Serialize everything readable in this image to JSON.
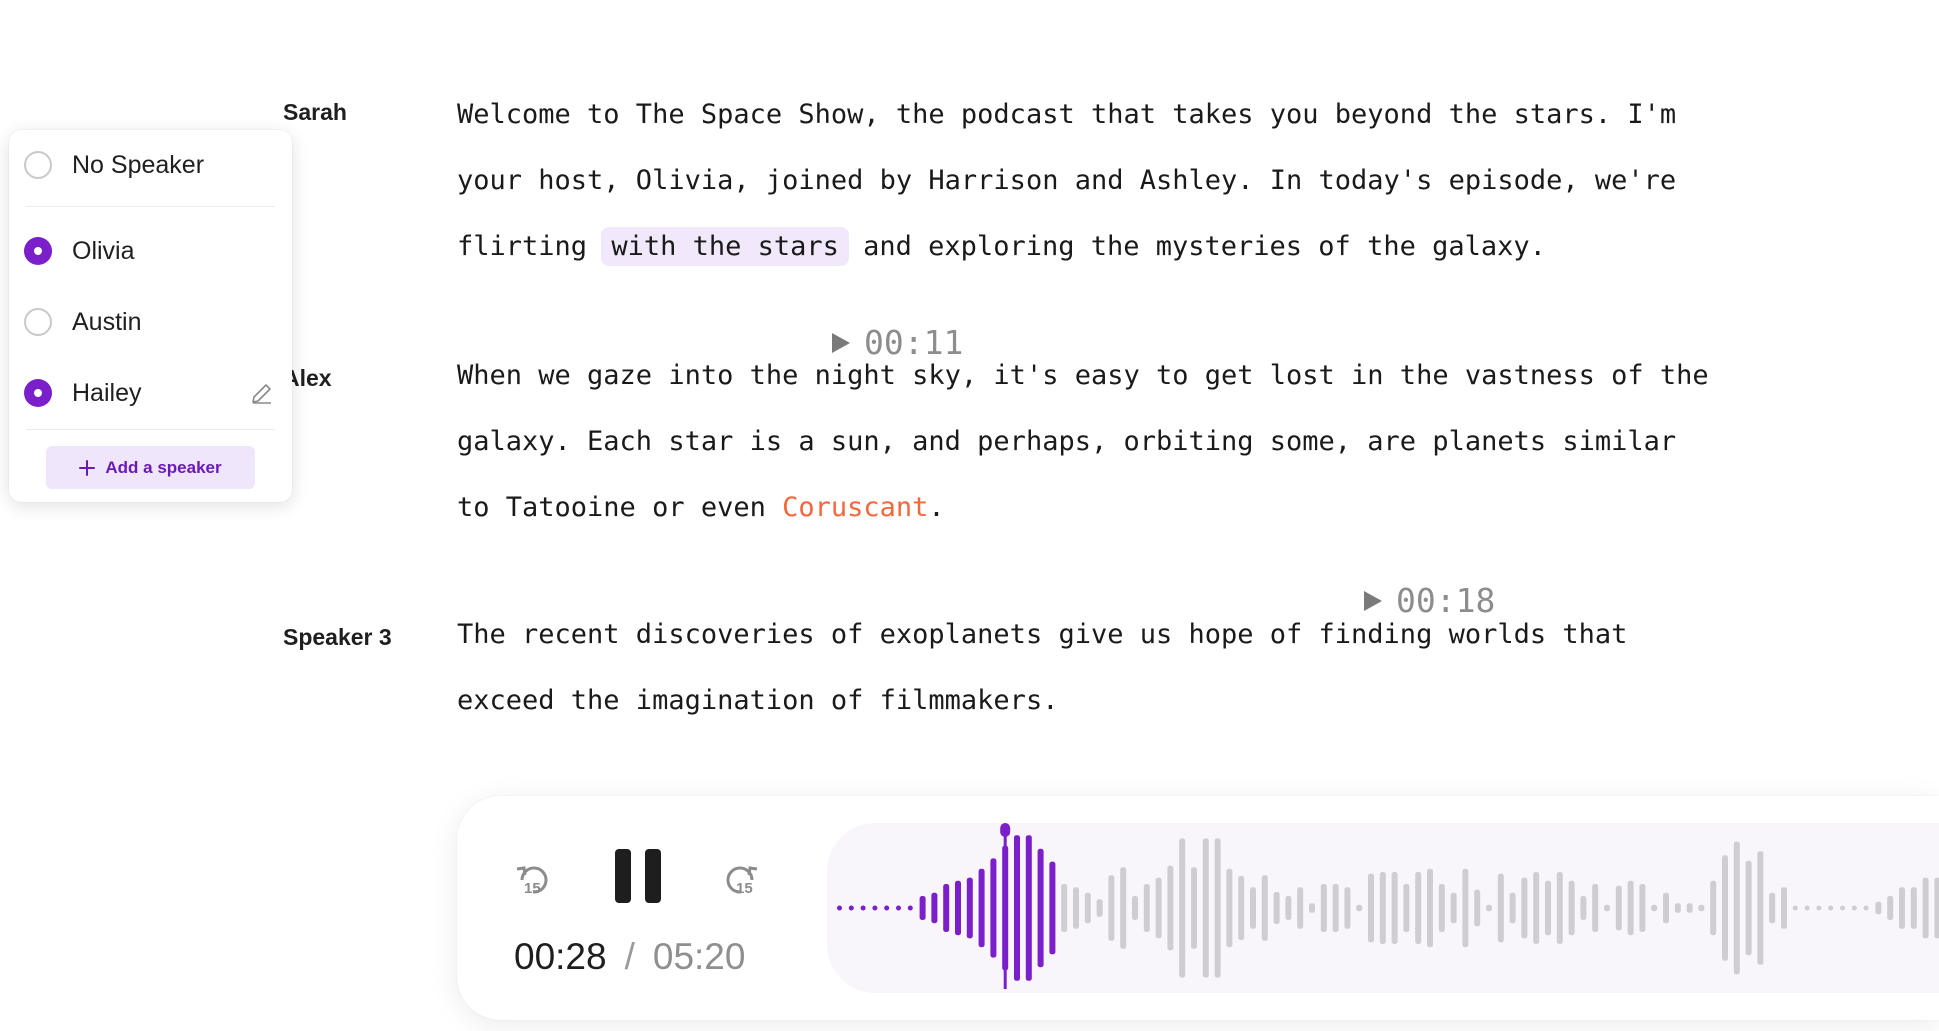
{
  "transcript": {
    "blocks": [
      {
        "speaker": "Sarah",
        "lines": [
          [
            {
              "t": "Welcome to The Space Show, the podcast that takes you beyond the stars. I'm"
            }
          ],
          [
            {
              "t": "your host, Olivia, joined by Harrison and Ashley. In today's episode, we're"
            }
          ],
          [
            {
              "t": "flirting "
            },
            {
              "t": "with the stars",
              "style": "highlight"
            },
            {
              "t": " and exploring the mysteries of the galaxy."
            }
          ]
        ]
      },
      {
        "speaker": "Alex",
        "timestamp": "00:11",
        "lines": [
          [
            {
              "t": "When we gaze into the night sky, it's easy to get lost in the vastness of the"
            }
          ],
          [
            {
              "t": "galaxy. Each star is a sun, and perhaps, orbiting some, are planets similar"
            }
          ],
          [
            {
              "t": "to Tatooine or even "
            },
            {
              "t": "Coruscant",
              "style": "error"
            },
            {
              "t": "."
            }
          ]
        ]
      },
      {
        "speaker": "Speaker 3",
        "timestamp": "00:18",
        "lines": [
          [
            {
              "t": "The recent discoveries of exoplanets give us hope of finding worlds that"
            }
          ],
          [
            {
              "t": "exceed the imagination of filmmakers."
            }
          ]
        ]
      }
    ]
  },
  "speaker_menu": {
    "options": [
      {
        "label": "No Speaker",
        "selected": false
      },
      {
        "label": "Olivia",
        "selected": true
      },
      {
        "label": "Austin",
        "selected": false
      },
      {
        "label": "Hailey",
        "selected": true,
        "editable": true
      }
    ],
    "add_label": "Add a speaker"
  },
  "player": {
    "current_time": "00:28",
    "separator": "/",
    "total_time": "05:20",
    "skip_back_label": "15",
    "skip_forward_label": "15",
    "state": "playing",
    "progress_fraction": 0.0875,
    "colors": {
      "played": "#7a1fc9",
      "unplayed": "#cfcdd2",
      "accent": "#7a1fc9"
    },
    "waveform_levels": [
      0.03,
      0.03,
      0.03,
      0.03,
      0.03,
      0.03,
      0.03,
      0.15,
      0.19,
      0.3,
      0.34,
      0.38,
      0.49,
      0.62,
      0.78,
      0.91,
      0.91,
      0.74,
      0.58,
      0.3,
      0.26,
      0.19,
      0.11,
      0.41,
      0.51,
      0.15,
      0.3,
      0.38,
      0.53,
      0.87,
      0.51,
      0.87,
      0.87,
      0.49,
      0.4,
      0.26,
      0.41,
      0.2,
      0.15,
      0.26,
      0.06,
      0.3,
      0.3,
      0.26,
      0.04,
      0.43,
      0.45,
      0.45,
      0.3,
      0.45,
      0.49,
      0.3,
      0.19,
      0.49,
      0.23,
      0.04,
      0.43,
      0.19,
      0.38,
      0.45,
      0.34,
      0.45,
      0.34,
      0.15,
      0.3,
      0.04,
      0.28,
      0.34,
      0.3,
      0.04,
      0.19,
      0.06,
      0.06,
      0.04,
      0.34,
      0.66,
      0.83,
      0.59,
      0.71,
      0.19,
      0.26,
      0.03,
      0.03,
      0.03,
      0.03,
      0.03,
      0.03,
      0.03,
      0.08,
      0.15,
      0.26,
      0.26,
      0.38,
      0.38,
      0.38
    ]
  }
}
